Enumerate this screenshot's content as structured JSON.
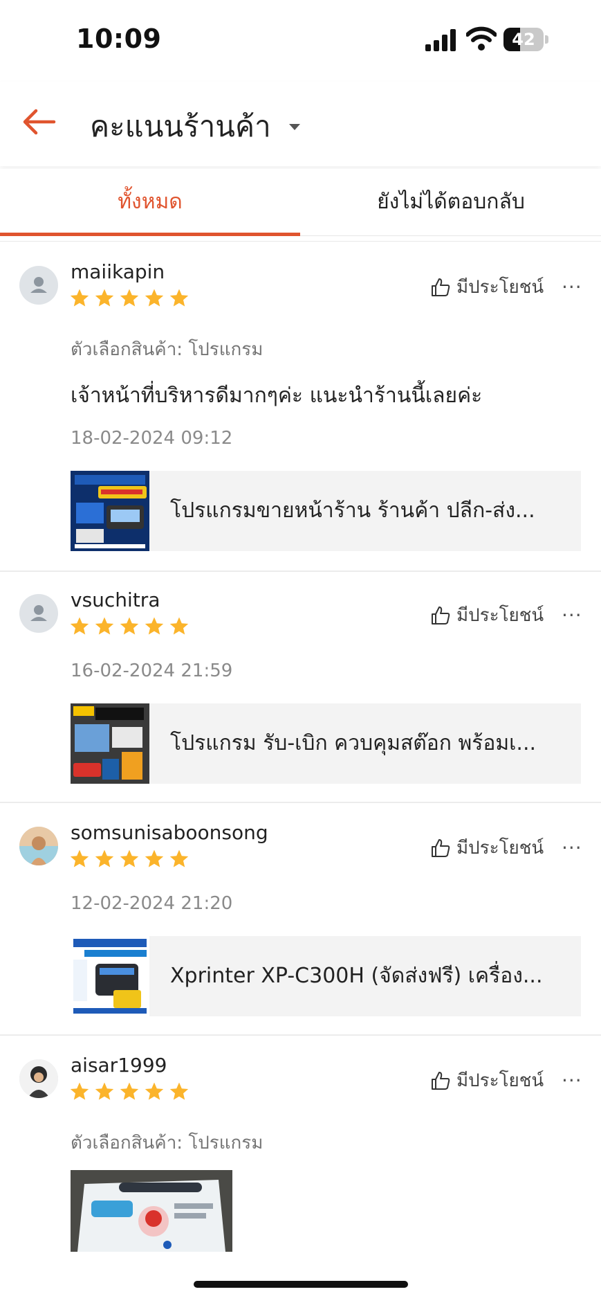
{
  "status_bar": {
    "time": "10:09",
    "battery": "42",
    "battery_level": 0.42
  },
  "header": {
    "title": "คะแนนร้านค้า",
    "back_icon": "arrow-left-icon",
    "dropdown_icon": "caret-down-icon"
  },
  "tabs": [
    {
      "label": "ทั้งหมด",
      "active": true
    },
    {
      "label": "ยังไม่ได้ตอบกลับ",
      "active": false
    }
  ],
  "reviews": [
    {
      "username": "maiikapin",
      "rating": 5,
      "helpful_label": "มีประโยชน์",
      "more_label": "···",
      "variant": "ตัวเลือกสินค้า: โปรแกรม",
      "comment": "เจ้าหน้าที่บริหารดีมากๆค่ะ แนะนำร้านนี้เลยค่ะ",
      "date": "18-02-2024 09:12",
      "product_name": "โปรแกรมขายหน้าร้าน ร้านค้า ปลีก-ส่ง..."
    },
    {
      "username": "vsuchitra",
      "rating": 5,
      "helpful_label": "มีประโยชน์",
      "more_label": "···",
      "date": "16-02-2024 21:59",
      "product_name": "โปรแกรม รับ-เบิก ควบคุมสต๊อก พร้อมเ..."
    },
    {
      "username": "somsunisaboonsong",
      "rating": 5,
      "helpful_label": "มีประโยชน์",
      "more_label": "···",
      "date": "12-02-2024 21:20",
      "product_name": "Xprinter XP-C300H (จัดส่งฟรี) เครื่อง..."
    },
    {
      "username": "aisar1999",
      "rating": 5,
      "helpful_label": "มีประโยชน์",
      "more_label": "···",
      "variant": "ตัวเลือกสินค้า: โปรแกรม"
    }
  ],
  "colors": {
    "accent": "#e0542e",
    "star": "#fbb42b",
    "divider": "#ececec"
  }
}
